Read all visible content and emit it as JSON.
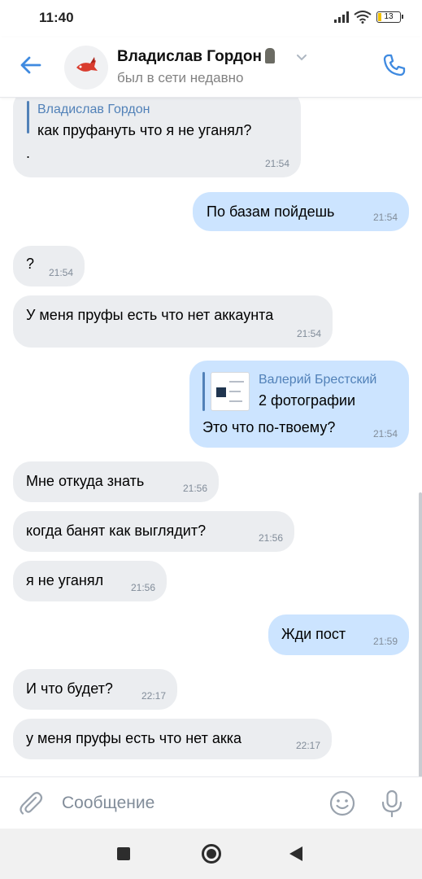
{
  "status_bar": {
    "time": "11:40",
    "battery": "13"
  },
  "header": {
    "contact_name": "Владислав Гордон",
    "contact_status": "был в сети недавно"
  },
  "messages": [
    {
      "direction": "in",
      "reply_to": {
        "name": "Владислав Гордон",
        "text": "как пруфануть что я не уганял?"
      },
      "text": ".",
      "time": "21:54"
    },
    {
      "direction": "out",
      "text": "По базам пойдешь",
      "time": "21:54"
    },
    {
      "direction": "in",
      "text": "?",
      "time": "21:54"
    },
    {
      "direction": "in",
      "text": "У меня пруфы есть что нет аккаунта",
      "time": "21:54"
    },
    {
      "direction": "out",
      "reply_to": {
        "name": "Валерий Брестский",
        "text": "2 фотографии"
      },
      "text": "Это что по-твоему?",
      "time": "21:54"
    },
    {
      "direction": "in",
      "text": "Мне откуда знать",
      "time": "21:56"
    },
    {
      "direction": "in",
      "text": "когда банят как выглядит?",
      "time": "21:56"
    },
    {
      "direction": "in",
      "text": "я не уганял",
      "time": "21:56"
    },
    {
      "direction": "out",
      "text": "Жди пост",
      "time": "21:59"
    },
    {
      "direction": "in",
      "text": "И что будет?",
      "time": "22:17"
    },
    {
      "direction": "in",
      "text": "у меня пруфы есть что нет акка",
      "time": "22:17"
    }
  ],
  "composer": {
    "placeholder": "Сообщение"
  },
  "icons": {
    "back": "arrow-left-icon",
    "call": "phone-icon",
    "attach": "paperclip-icon",
    "emoji": "smiley-icon",
    "mic": "microphone-icon",
    "avatar": "fish-avatar"
  },
  "colors": {
    "accent": "#5181b8",
    "incoming_bubble": "#ebedf0",
    "outgoing_bubble": "#cce4ff",
    "secondary_text": "#818c99"
  }
}
